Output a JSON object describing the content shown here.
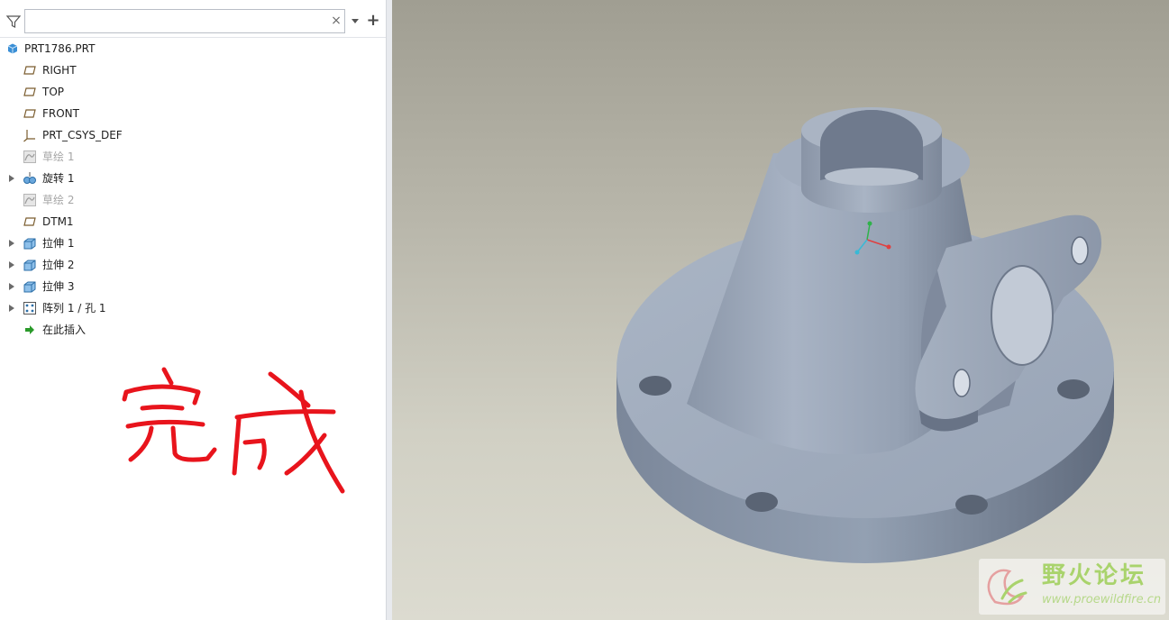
{
  "search": {
    "value": "",
    "placeholder": ""
  },
  "tree": {
    "items": [
      {
        "label": "PRT1786.PRT",
        "icon": "part-icon",
        "level": 0,
        "expandable": false,
        "dimmed": false
      },
      {
        "label": "RIGHT",
        "icon": "datum-plane-icon",
        "level": 1,
        "expandable": false,
        "dimmed": false
      },
      {
        "label": "TOP",
        "icon": "datum-plane-icon",
        "level": 1,
        "expandable": false,
        "dimmed": false
      },
      {
        "label": "FRONT",
        "icon": "datum-plane-icon",
        "level": 1,
        "expandable": false,
        "dimmed": false
      },
      {
        "label": "PRT_CSYS_DEF",
        "icon": "coordinate-system-icon",
        "level": 1,
        "expandable": false,
        "dimmed": false
      },
      {
        "label": "草绘 1",
        "icon": "sketch-icon",
        "level": 1,
        "expandable": false,
        "dimmed": true
      },
      {
        "label": "旋转 1",
        "icon": "revolve-icon",
        "level": 1,
        "expandable": true,
        "dimmed": false
      },
      {
        "label": "草绘 2",
        "icon": "sketch-icon",
        "level": 1,
        "expandable": false,
        "dimmed": true
      },
      {
        "label": "DTM1",
        "icon": "datum-plane-icon",
        "level": 1,
        "expandable": false,
        "dimmed": false
      },
      {
        "label": "拉伸 1",
        "icon": "extrude-icon",
        "level": 1,
        "expandable": true,
        "dimmed": false
      },
      {
        "label": "拉伸 2",
        "icon": "extrude-icon",
        "level": 1,
        "expandable": true,
        "dimmed": false
      },
      {
        "label": "拉伸 3",
        "icon": "extrude-icon",
        "level": 1,
        "expandable": true,
        "dimmed": false
      },
      {
        "label": "阵列 1 / 孔 1",
        "icon": "pattern-icon",
        "level": 1,
        "expandable": true,
        "dimmed": false
      },
      {
        "label": "在此插入",
        "icon": "insert-here-arrow-icon",
        "level": 1,
        "expandable": false,
        "dimmed": false
      }
    ]
  },
  "handwriting": {
    "text": "完成",
    "color": "#e8141c"
  },
  "watermark": {
    "title": "野火论坛",
    "url": "www.proewildfire.cn"
  },
  "colors": {
    "accent_blue": "#3a8fd6",
    "model_metal": "#9aa6b8",
    "dimmed_text": "#a6a6a6"
  }
}
